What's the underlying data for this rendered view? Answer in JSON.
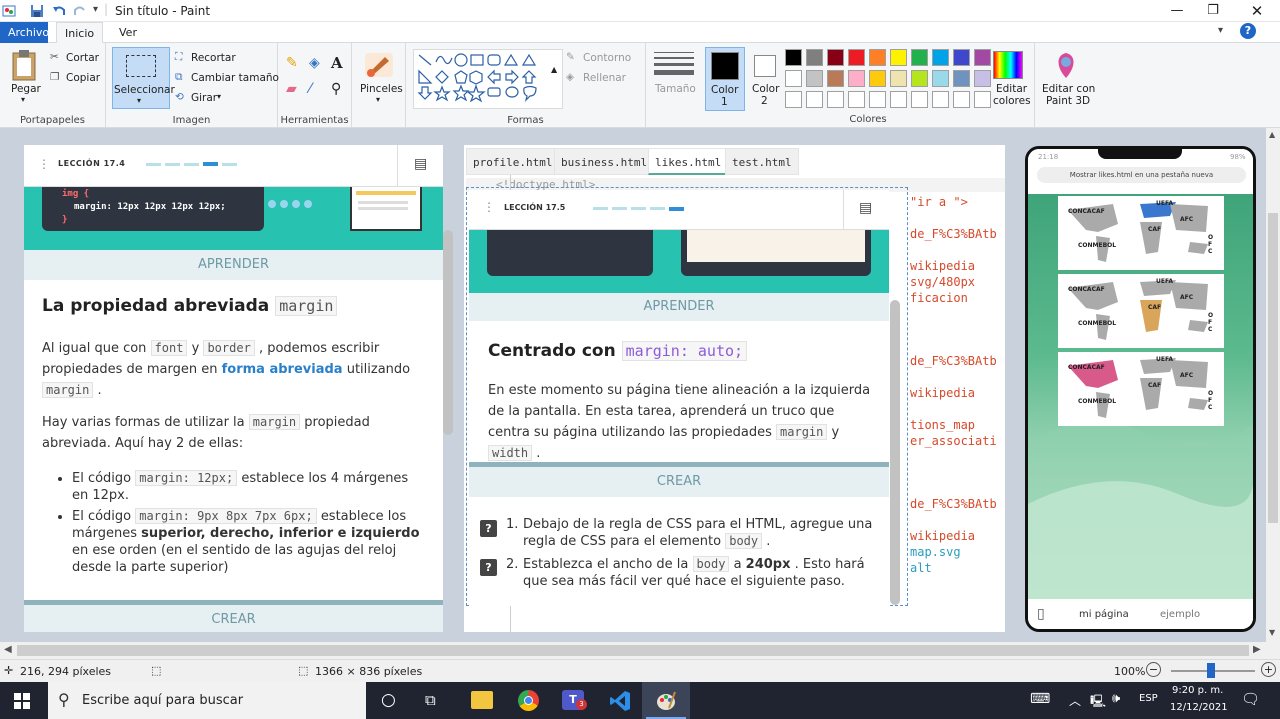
{
  "window": {
    "title": "Sin título - Paint"
  },
  "menu": {
    "file": "Archivo",
    "home": "Inicio",
    "view": "Ver"
  },
  "ribbon": {
    "clipboard": {
      "paste": "Pegar",
      "cut": "Cortar",
      "copy": "Copiar",
      "label": "Portapapeles"
    },
    "image": {
      "select": "Seleccionar",
      "crop": "Recortar",
      "resize": "Cambiar tamaño",
      "rotate": "Girar",
      "label": "Imagen"
    },
    "tools": {
      "label": "Herramientas"
    },
    "brushes": {
      "label": "Pinceles"
    },
    "shapes": {
      "outline": "Contorno",
      "fill": "Rellenar",
      "label": "Formas"
    },
    "size": {
      "label": "Tamaño"
    },
    "color1": {
      "label": "Color",
      "num": "1"
    },
    "color2": {
      "label": "Color",
      "num": "2"
    },
    "colors": {
      "label": "Colores",
      "edit_l1": "Editar",
      "edit_l2": "colores"
    },
    "paint3d": {
      "l1": "Editar con",
      "l2": "Paint 3D"
    },
    "palette_row1": [
      "#000000",
      "#7f7f7f",
      "#880015",
      "#ed1c24",
      "#ff7f27",
      "#fff200",
      "#22b14c",
      "#00a2e8",
      "#3f48cc",
      "#a349a4"
    ],
    "palette_row2": [
      "#ffffff",
      "#c3c3c3",
      "#b97a57",
      "#ffaec9",
      "#ffc90e",
      "#efe4b0",
      "#b5e61d",
      "#99d9ea",
      "#7092be",
      "#c8bfe7"
    ]
  },
  "left_panel": {
    "lesson": "LECCIÓN 17.4",
    "code1": "img {",
    "code2": "margin: 12px 12px 12px 12px;",
    "code3": "}",
    "learn": "APRENDER",
    "heading": "La propiedad abreviada",
    "heading_code": "margin",
    "p1_a": "Al igual que con",
    "p1_code1": "font",
    "p1_b": "y",
    "p1_code2": "border",
    "p1_c": ", podemos escribir propiedades de margen en",
    "p1_link": "forma abreviada",
    "p1_d": "utilizando",
    "p1_code3": "margin",
    "p1_e": ".",
    "p2_a": "Hay varias formas de utilizar la",
    "p2_code": "margin",
    "p2_b": "propiedad abreviada. Aquí hay 2 de ellas:",
    "li1_a": "El código",
    "li1_code": "margin: 12px;",
    "li1_b": "establece los 4 márgenes en 12px.",
    "li2_a": "El código",
    "li2_code": "margin: 9px 8px 7px 6px;",
    "li2_b": "establece los márgenes",
    "li2_bold": "superior, derecho, inferior e izquierdo",
    "li2_c": "en ese orden (en el sentido de las agujas del reloj desde la parte superior)",
    "create": "CREAR"
  },
  "editor": {
    "tabs": [
      "profile.html",
      "business.html",
      "likes.html",
      "test.html"
    ],
    "line1": "<!doctype html>",
    "code_lines": [
      "\"ir a \">",
      "de_F%C3%BAtb",
      "wikipedia",
      "svg/480px",
      "ficacion",
      "de_F%C3%BAtb",
      "wikipedia",
      "tions_map",
      "er_associati",
      "de_F%C3%BAtb",
      "wikipedia",
      "map.svg",
      "alt"
    ]
  },
  "overlay": {
    "lesson": "LECCIÓN 17.5",
    "learn": "APRENDER",
    "heading": "Centrado con",
    "heading_code": "margin: auto;",
    "p_a": "En este momento su página tiene alineación a la izquierda de la pantalla. En esta tarea, aprenderá un truco que centra su página utilizando las propiedades",
    "p_code1": "margin",
    "p_b": "y",
    "p_code2": "width",
    "p_c": ".",
    "create": "CREAR",
    "s1_num": "1.",
    "s1_a": "Debajo de la regla de CSS para el HTML, agregue una regla de CSS para el elemento",
    "s1_code": "body",
    "s1_b": ".",
    "s2_num": "2.",
    "s2_a": "Establezca el ancho de la",
    "s2_code": "body",
    "s2_b": "a",
    "s2_bold": "240px",
    "s2_c": ". Esto hará que sea más fácil ver qué hace el siguiente paso."
  },
  "phone": {
    "time": "21:18",
    "battery": "98%",
    "banner": "Mostrar likes.html en una pestaña nueva",
    "maps": [
      {
        "l1": "CONCACAF",
        "l2": "UEFA",
        "l3": "AFC",
        "l4": "CAF",
        "l5": "CONMEBOL",
        "l6": "OFC"
      },
      {
        "l1": "CONCACAF",
        "l2": "UEFA",
        "l3": "AFC",
        "l4": "CAF",
        "l5": "CONMEBOL",
        "l6": "OFC"
      },
      {
        "l1": "CONCACAF",
        "l2": "UEFA",
        "l3": "AFC",
        "l4": "CAF",
        "l5": "CONMEBOL",
        "l6": "OFC"
      }
    ],
    "nav_page": "mi página",
    "nav_example": "ejemplo"
  },
  "status": {
    "cursor": "216, 294 píxeles",
    "size": "1366 × 836 píxeles",
    "zoom": "100%"
  },
  "taskbar": {
    "search": "Escribe aquí para buscar",
    "lang": "ESP",
    "time": "9:20 p. m.",
    "date": "12/12/2021",
    "teams_badge": "3"
  }
}
